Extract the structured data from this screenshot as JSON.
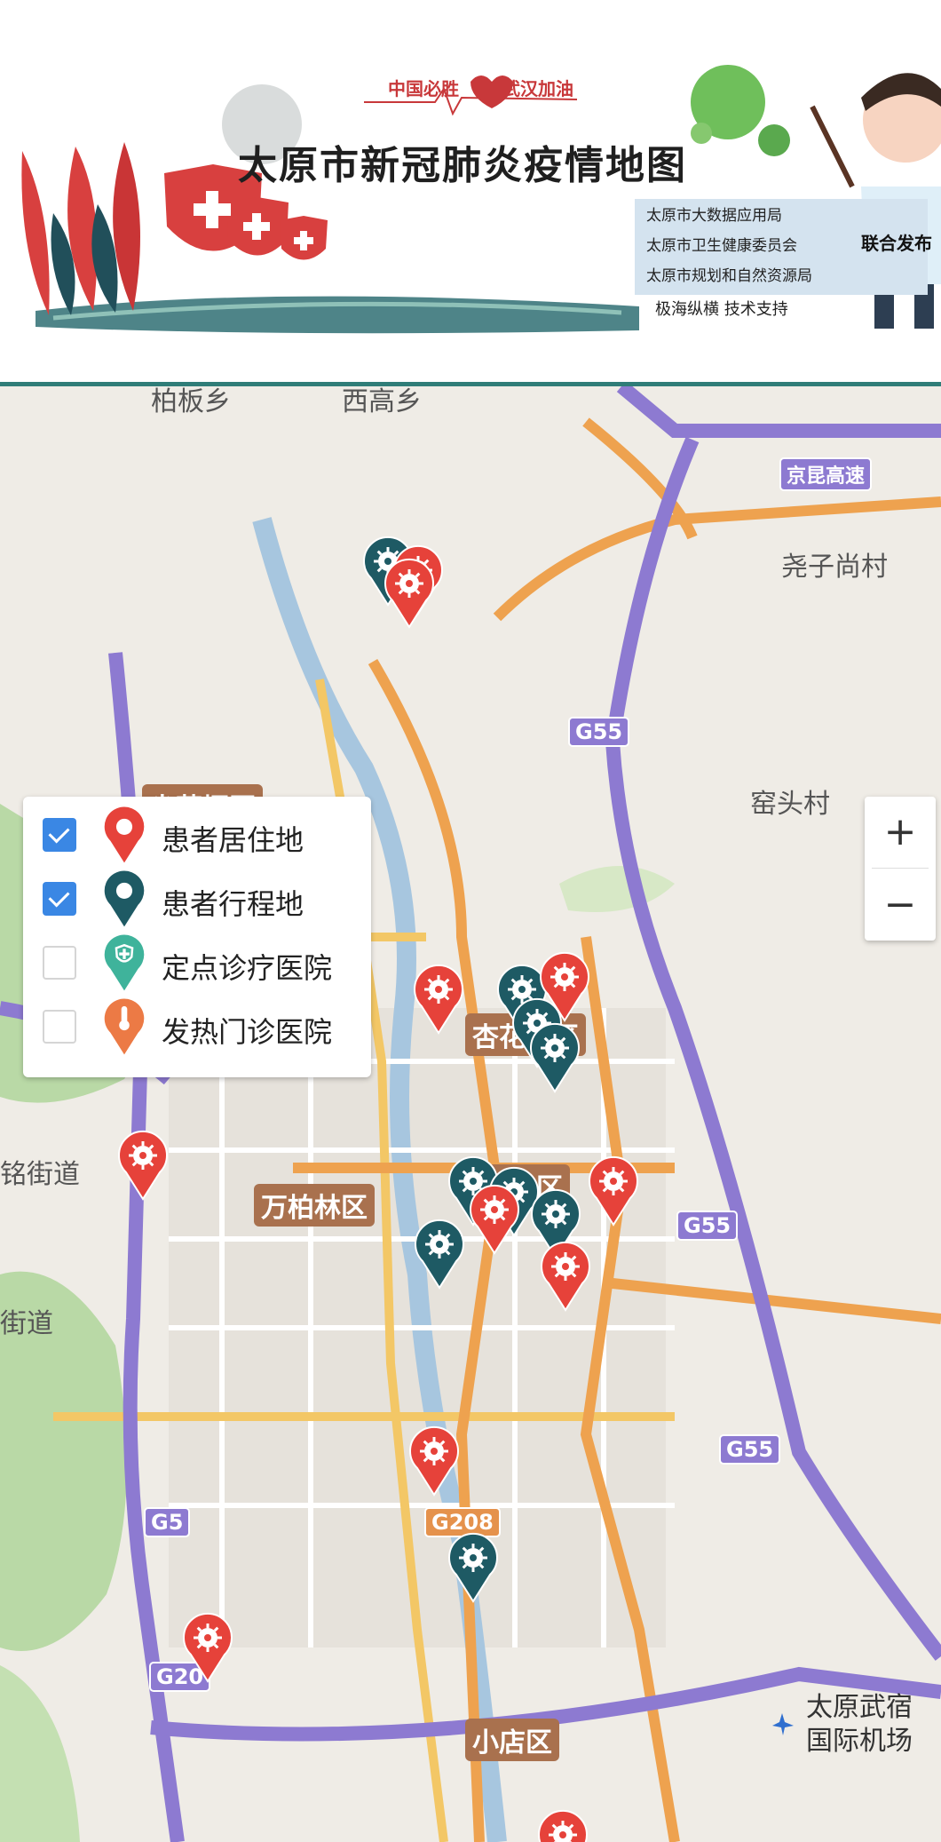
{
  "banner": {
    "slogan_left": "中国必胜",
    "slogan_right": "武汉加油",
    "title": "太原市新冠肺炎疫情地图",
    "agencies": [
      "太原市大数据应用局",
      "太原市卫生健康委员会",
      "太原市规划和自然资源局"
    ],
    "tech_support": "极海纵横  技术支持",
    "joint_release": "联合发布"
  },
  "legend": {
    "items": [
      {
        "label": "患者居住地",
        "checked": true,
        "icon": "virus-pin-icon",
        "color": "#e6423a"
      },
      {
        "label": "患者行程地",
        "checked": true,
        "icon": "virus-pin-icon",
        "color": "#1e5a64"
      },
      {
        "label": "定点诊疗医院",
        "checked": false,
        "icon": "shield-cross-pin-icon",
        "color": "#3fb39b"
      },
      {
        "label": "发热门诊医院",
        "checked": false,
        "icon": "thermometer-pin-icon",
        "color": "#ec7a45"
      }
    ]
  },
  "zoom": {
    "in": "+",
    "out": "−"
  },
  "map": {
    "place_labels": [
      "柏板乡",
      "西高乡",
      "尧子尚村",
      "窑头村",
      "铭街道",
      "街道",
      "太原武宿",
      "国际机场"
    ],
    "districts": [
      "尖草坪区",
      "杏花岭区",
      "万柏林区",
      "迎泽区",
      "小店区"
    ],
    "roads": [
      "G55",
      "G55",
      "G55",
      "G5",
      "G5",
      "G20",
      "G208",
      "京昆高速"
    ]
  }
}
